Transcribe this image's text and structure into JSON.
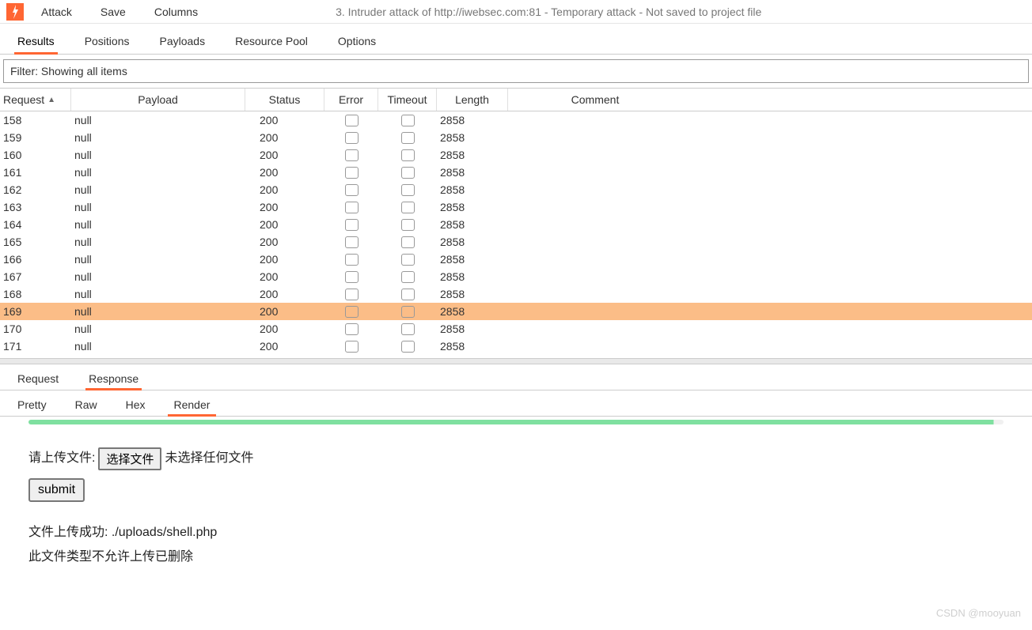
{
  "menu": {
    "attack": "Attack",
    "save": "Save",
    "columns": "Columns"
  },
  "window": {
    "title": "3. Intruder attack of http://iwebsec.com:81 - Temporary attack - Not saved to project file"
  },
  "tabs": {
    "results": "Results",
    "positions": "Positions",
    "payloads": "Payloads",
    "resource_pool": "Resource Pool",
    "options": "Options",
    "active": "results"
  },
  "filter": {
    "text": "Filter: Showing all items"
  },
  "columns": {
    "request": "Request",
    "payload": "Payload",
    "status": "Status",
    "error": "Error",
    "timeout": "Timeout",
    "length": "Length",
    "comment": "Comment"
  },
  "rows": [
    {
      "request": "158",
      "payload": "null",
      "status": "200",
      "length": "2858",
      "selected": false
    },
    {
      "request": "159",
      "payload": "null",
      "status": "200",
      "length": "2858",
      "selected": false
    },
    {
      "request": "160",
      "payload": "null",
      "status": "200",
      "length": "2858",
      "selected": false
    },
    {
      "request": "161",
      "payload": "null",
      "status": "200",
      "length": "2858",
      "selected": false
    },
    {
      "request": "162",
      "payload": "null",
      "status": "200",
      "length": "2858",
      "selected": false
    },
    {
      "request": "163",
      "payload": "null",
      "status": "200",
      "length": "2858",
      "selected": false
    },
    {
      "request": "164",
      "payload": "null",
      "status": "200",
      "length": "2858",
      "selected": false
    },
    {
      "request": "165",
      "payload": "null",
      "status": "200",
      "length": "2858",
      "selected": false
    },
    {
      "request": "166",
      "payload": "null",
      "status": "200",
      "length": "2858",
      "selected": false
    },
    {
      "request": "167",
      "payload": "null",
      "status": "200",
      "length": "2858",
      "selected": false
    },
    {
      "request": "168",
      "payload": "null",
      "status": "200",
      "length": "2858",
      "selected": false
    },
    {
      "request": "169",
      "payload": "null",
      "status": "200",
      "length": "2858",
      "selected": true
    },
    {
      "request": "170",
      "payload": "null",
      "status": "200",
      "length": "2858",
      "selected": false
    },
    {
      "request": "171",
      "payload": "null",
      "status": "200",
      "length": "2858",
      "selected": false
    }
  ],
  "detail_tabs": {
    "request": "Request",
    "response": "Response",
    "active": "response"
  },
  "format_tabs": {
    "pretty": "Pretty",
    "raw": "Raw",
    "hex": "Hex",
    "render": "Render",
    "active": "render"
  },
  "render": {
    "upload_label": "请上传文件:",
    "choose_file_btn": "选择文件",
    "no_file": "未选择任何文件",
    "submit": "submit",
    "success_line": "文件上传成功: ./uploads/shell.php",
    "deny_line": "此文件类型不允许上传已删除"
  },
  "watermark": "CSDN @mooyuan"
}
